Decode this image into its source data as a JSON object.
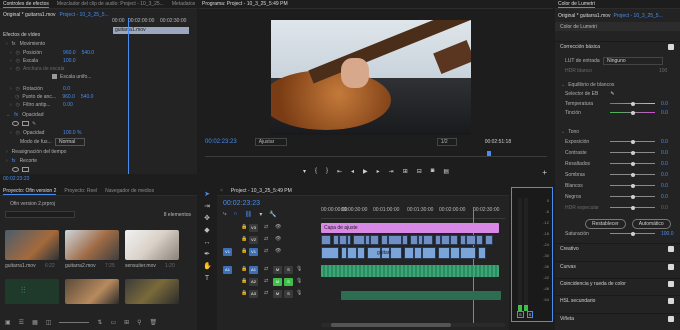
{
  "effects_panel": {
    "tabs": [
      "Controles de efectos",
      "Mezclador del clip de audio: Project - 10_3_25...",
      "Metadatos"
    ],
    "source_label": "Original * guitarra1.mov",
    "sequence_label": "Project - 10_3_25_5...",
    "ruler_times": [
      "00:00",
      "00:02:00:00",
      "00:02:30:00"
    ],
    "clip_name": "guitarra1.mov",
    "section_video": "Efectos de vídeo",
    "fx_movimiento": "Movimiento",
    "posicion_label": "Posición",
    "posicion_x": "960.0",
    "posicion_y": "540.0",
    "escala_label": "Escala",
    "escala_val": "100.0",
    "anchura_label": "Anchura de escala",
    "uniforme_label": "Escala unifo...",
    "rotacion_label": "Rotación",
    "rotacion_val": "0.0",
    "punto_label": "Punto de anc...",
    "punto_x": "960.0",
    "punto_y": "540.0",
    "filtro_label": "Filtro antip...",
    "filtro_val": "0.00",
    "opacidad_label": "Opacidad",
    "opacidad_sub_label": "Opacidad",
    "opacidad_val": "100.0 %",
    "fusion_label": "Modo de fus...",
    "fusion_val": "Normal",
    "remap_label": "Reasignación del tiempo",
    "recorte_label": "Recorte",
    "timecode": "00:02:23:23"
  },
  "program_monitor": {
    "title": "Programa: Project - 10_3_25_5:49 PM",
    "timecode": "00:02:23:23",
    "fit_label": "Ajustar",
    "quality_label": "1/2",
    "duration": "00:02:51:18"
  },
  "lumetri_panel": {
    "title": "Color de Lumetri",
    "source_label": "Original * guitarra1.mov",
    "sequence_label": "Project - 10_3_25_5...",
    "fx_name": "Color de Lumetri",
    "basic_header": "Corrección básica",
    "lut_label": "LUT de entrada",
    "lut_val": "Ninguno",
    "hdr_label": "HDR blanco",
    "hdr_val": "100",
    "wb_header": "Equilibrio de blancos",
    "wb_selector": "Selector de EB",
    "temperatura": "Temperatura",
    "temperatura_val": "0.0",
    "tinte": "Tinción",
    "tinte_val": "0.0",
    "tono_header": "Tono",
    "exposicion": "Exposición",
    "exposicion_val": "0.0",
    "contraste": "Contraste",
    "contraste_val": "0.0",
    "resaltados": "Resaltados",
    "resaltados_val": "0.0",
    "sombras": "Sombras",
    "sombras_val": "0.0",
    "blancos": "Blancos",
    "blancos_val": "0.0",
    "negros": "Negros",
    "negros_val": "0.0",
    "hdr_espec": "HDR especular",
    "hdr_espec_val": "0.0",
    "restablecer": "Restablecer",
    "automatico": "Automático",
    "saturacion": "Saturación",
    "saturacion_val": "100.0",
    "sections": [
      "Creativo",
      "Curvas",
      "Coincidencia y rueda de color",
      "HSL secundario",
      "Viñeta"
    ]
  },
  "project_panel": {
    "tabs": [
      "Proyecto: Ofin version 2",
      "Proyecto: Reel",
      "Navegador de medios"
    ],
    "filename": "Ofin version 2.prproj",
    "count": "8 elementos",
    "clips": [
      {
        "name": "guitarra1.mov",
        "dur": "6:22"
      },
      {
        "name": "guitarra2.mov",
        "dur": "7:25"
      },
      {
        "name": "sensuiter.mov",
        "dur": "1:20"
      }
    ]
  },
  "timeline": {
    "title": "Project - 10_3_25_5:49 PM",
    "timecode": "00:02:23:23",
    "ruler": [
      "00:00:00:00",
      "00:00:30:00",
      "00:01:00:00",
      "00:01:30:00",
      "00:02:00:00",
      "00:02:30:00"
    ],
    "video_tracks": [
      "V3",
      "V2",
      "V1"
    ],
    "audio_tracks": [
      "A1",
      "A2",
      "A3"
    ],
    "source_v": "V1",
    "source_a": "A1",
    "track_letters": {
      "mute": "M",
      "solo": "S"
    },
    "adjust_clip": "Capa de ajuste",
    "v1_clip": "guitarr"
  },
  "audio_meter": {
    "scale": [
      "0",
      "-6",
      "-12",
      "-18",
      "-24",
      "-30",
      "-36",
      "-42",
      "-48",
      "-54"
    ],
    "channels": [
      "S",
      "S"
    ]
  },
  "colors": {
    "accent": "#4a8df0",
    "adjust_layer": "#d889e6",
    "video_clip": "#7ba5d9",
    "audio_clip": "#4fc08a"
  }
}
